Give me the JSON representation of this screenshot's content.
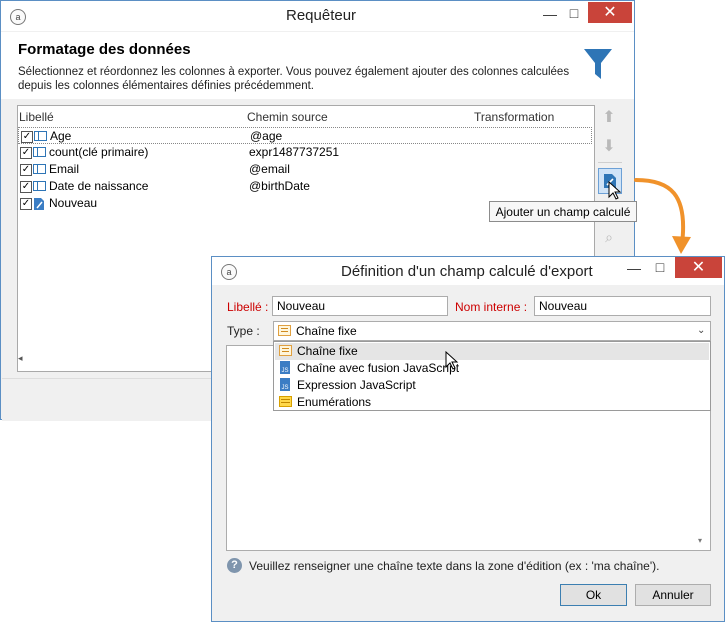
{
  "main_window": {
    "title": "Requêteur",
    "app_icon": "adobe-campaign-icon",
    "header_title": "Formatage des données",
    "header_desc_line1": "Sélectionnez et réordonnez les colonnes à exporter. Vous pouvez également ajouter des colonnes calculées",
    "header_desc_line2": "depuis les colonnes élémentaires définies précédemment.",
    "columns": [
      "Libellé",
      "Chemin source",
      "Transformation"
    ],
    "rows": [
      {
        "label": "Age",
        "path": "@age",
        "checked": true
      },
      {
        "label": "count(clé primaire)",
        "path": "expr1487737251",
        "checked": true
      },
      {
        "label": "Email",
        "path": "@email",
        "checked": true
      },
      {
        "label": "Date de naissance",
        "path": "@birthDate",
        "checked": true
      },
      {
        "label": "Nouveau",
        "path": "",
        "checked": true
      }
    ],
    "tooltip": "Ajouter un champ calculé"
  },
  "dialog": {
    "title": "Définition d'un champ calculé d'export",
    "label_caption": "Libellé :",
    "label_value": "Nouveau",
    "internal_caption": "Nom interne :",
    "internal_value": "Nouveau",
    "type_caption": "Type :",
    "type_selected": "Chaîne fixe",
    "type_options": [
      "Chaîne fixe",
      "Chaîne avec fusion JavaScript",
      "Expression JavaScript",
      "Enumérations"
    ],
    "hint": "Veuillez renseigner une chaîne texte dans la zone d'édition (ex : 'ma chaîne').",
    "ok_label": "Ok",
    "cancel_label": "Annuler"
  },
  "colors": {
    "accent": "#2e75b6",
    "close": "#c9443a",
    "arrow": "#f0922b",
    "required": "#cc0000"
  }
}
